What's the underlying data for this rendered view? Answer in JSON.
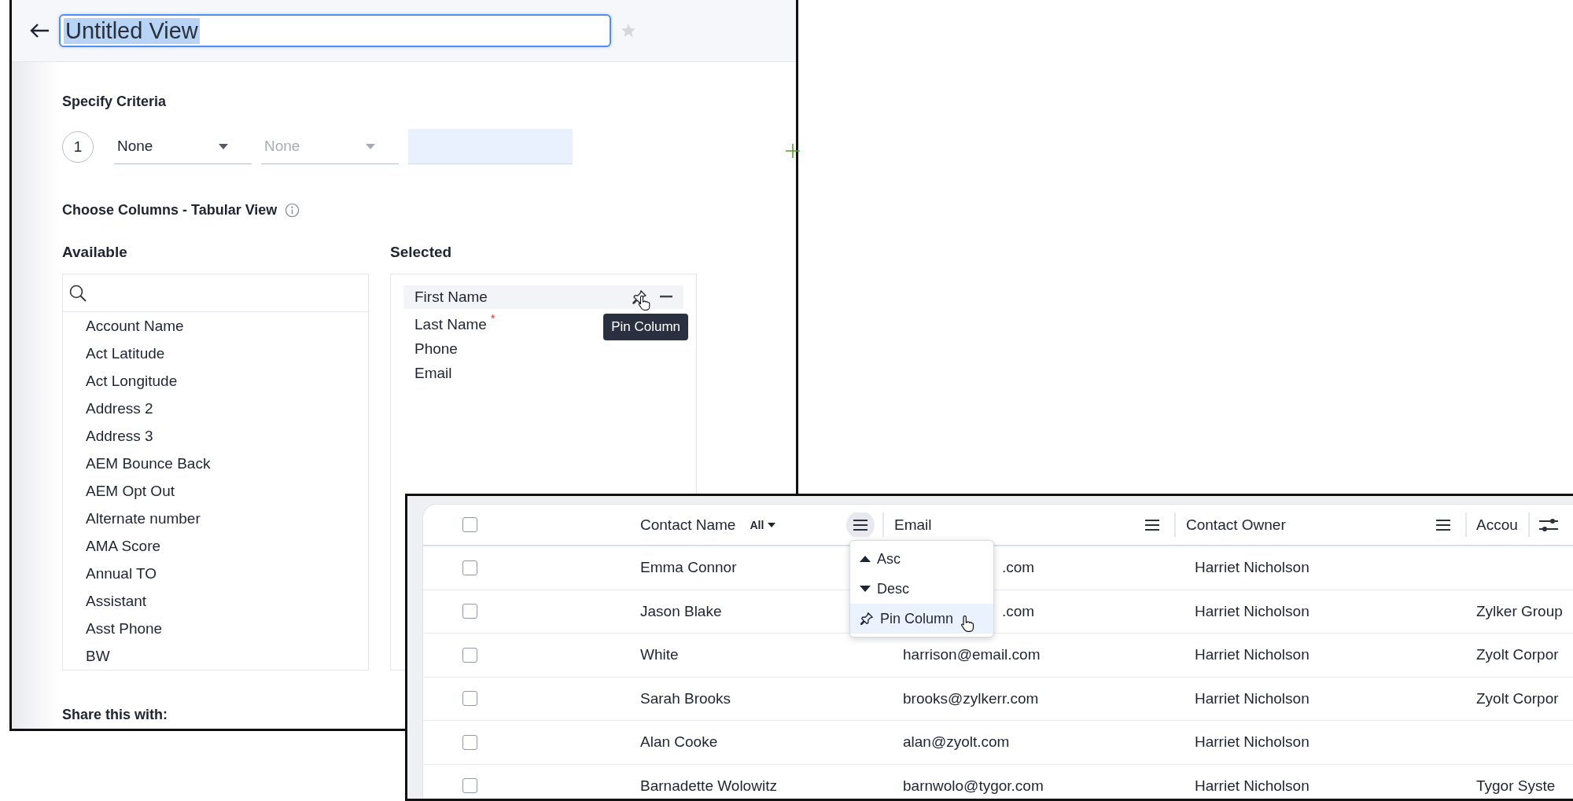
{
  "editor": {
    "title_field": {
      "value": "Untitled View",
      "text_selected": true
    },
    "criteria": {
      "heading": "Specify Criteria",
      "rows": [
        {
          "number": "1",
          "dropdowns": [
            {
              "value": "None",
              "disabled": false
            },
            {
              "value": "None",
              "disabled": true
            }
          ]
        }
      ]
    },
    "columns": {
      "heading": "Choose Columns - Tabular View",
      "available": {
        "label": "Available",
        "items": [
          "Account Name",
          "Act Latitude",
          "Act Longitude",
          "Address 2",
          "Address 3",
          "AEM Bounce Back",
          "AEM Opt Out",
          "Alternate number",
          "AMA Score",
          "Annual TO",
          "Assistant",
          "Asst Phone",
          "BW"
        ]
      },
      "selected": {
        "label": "Selected",
        "items": [
          {
            "label": "First Name",
            "hovered": true
          },
          {
            "label": "Last Name",
            "required_mark": "*",
            "hovered": false
          },
          {
            "label": "Phone",
            "hovered": false
          },
          {
            "label": "Email",
            "hovered": false
          }
        ],
        "tooltip": "Pin Column"
      }
    },
    "share_heading": "Share this with:"
  },
  "table": {
    "all_checked": false,
    "columns": [
      {
        "label": "Contact Name",
        "filter": "All",
        "menu_open": true
      },
      {
        "label": "Email",
        "menu_open": false
      },
      {
        "label": "Contact Owner",
        "menu_open": false
      },
      {
        "label": "Accou"
      }
    ],
    "rows": [
      {
        "checked": false,
        "name": "Emma Connor",
        "email": ".com",
        "owner": "Harriet Nicholson"
      },
      {
        "checked": false,
        "name": "Jason Blake",
        "email": ".com",
        "owner": "Harriet Nicholson",
        "account": "Zylker Group"
      },
      {
        "checked": false,
        "name": "White",
        "email": "harrison@email.com",
        "owner": "Harriet Nicholson",
        "account": "Zyolt Corpor"
      },
      {
        "checked": false,
        "name": "Sarah Brooks",
        "email": "brooks@zylkerr.com",
        "owner": "Harriet Nicholson",
        "account": "Zyolt Corpor"
      },
      {
        "checked": false,
        "name": "Alan Cooke",
        "email": "alan@zyolt.com",
        "owner": "Harriet Nicholson"
      },
      {
        "checked": false,
        "name": "Barnadette Wolowitz",
        "email": "barnwolo@tygor.com",
        "owner": "Harriet Nicholson",
        "account": "Tygor Syste"
      }
    ],
    "menu": {
      "items": [
        {
          "label": "Asc",
          "kind": "asc",
          "selected": false
        },
        {
          "label": "Desc",
          "kind": "desc",
          "selected": false
        },
        {
          "label": "Pin Column",
          "kind": "pin",
          "selected": true
        }
      ]
    }
  }
}
